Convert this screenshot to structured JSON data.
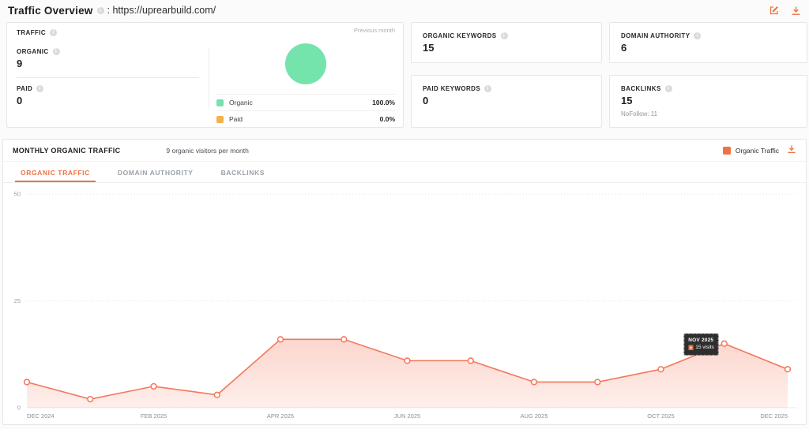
{
  "accent_color": "#ee7243",
  "header": {
    "title": "Traffic Overview",
    "separator": ": ",
    "url": "https://uprearbuild.com/"
  },
  "cards": {
    "traffic": {
      "label": "TRAFFIC",
      "previous_month": "Previous month",
      "organic_label": "ORGANIC",
      "organic_value": "9",
      "paid_label": "PAID",
      "paid_value": "0",
      "legend": [
        {
          "label": "Organic",
          "value": "100.0%",
          "color": "#74e3ac"
        },
        {
          "label": "Paid",
          "value": "0.0%",
          "color": "#f5b14d"
        }
      ]
    },
    "organic_keywords": {
      "label": "ORGANIC KEYWORDS",
      "value": "15"
    },
    "domain_authority": {
      "label": "DOMAIN AUTHORITY",
      "value": "6"
    },
    "paid_keywords": {
      "label": "PAID KEYWORDS",
      "value": "0"
    },
    "backlinks": {
      "label": "BACKLINKS",
      "value": "15",
      "nofollow": "NoFollow: 11"
    }
  },
  "monthly": {
    "title": "MONTHLY ORGANIC TRAFFIC",
    "subtitle": "9 organic visitors per month",
    "legend_label": "Organic Traffic",
    "tabs": [
      {
        "label": "ORGANIC TRAFFIC",
        "active": true
      },
      {
        "label": "DOMAIN AUTHORITY",
        "active": false
      },
      {
        "label": "BACKLINKS",
        "active": false
      }
    ]
  },
  "chart_data": {
    "type": "area",
    "title": "MONTHLY ORGANIC TRAFFIC",
    "x": [
      "DEC 2024",
      "JAN 2025",
      "FEB 2025",
      "MAR 2025",
      "APR 2025",
      "MAY 2025",
      "JUN 2025",
      "JUL 2025",
      "AUG 2025",
      "SEP 2025",
      "OCT 2025",
      "NOV 2025",
      "DEC 2025"
    ],
    "series": [
      {
        "name": "Organic Traffic",
        "values": [
          6,
          2,
          5,
          3,
          16,
          16,
          11,
          11,
          6,
          6,
          9,
          15,
          9
        ]
      }
    ],
    "ylim": [
      0,
      50
    ],
    "yticks": [
      0,
      25,
      50
    ],
    "x_tick_step": 2,
    "grid": "horizontal dotted",
    "legend_position": "top-right",
    "line_color": "#f4775a",
    "tooltip": {
      "month": "NOV 2025",
      "value_label": "15 visits",
      "index": 11
    }
  }
}
